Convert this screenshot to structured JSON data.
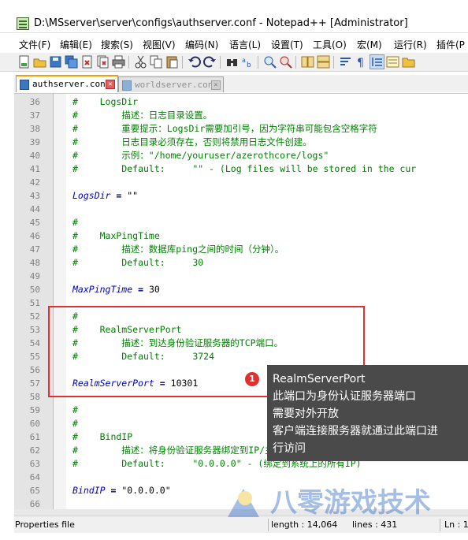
{
  "window": {
    "title": "D:\\MSserver\\server\\configs\\authserver.conf - Notepad++ [Administrator]"
  },
  "menu": [
    {
      "label": "文件(F)"
    },
    {
      "label": "编辑(E)"
    },
    {
      "label": "搜索(S)"
    },
    {
      "label": "视图(V)"
    },
    {
      "label": "编码(N)"
    },
    {
      "label": "语言(L)"
    },
    {
      "label": "设置(T)"
    },
    {
      "label": "工具(O)"
    },
    {
      "label": "宏(M)"
    },
    {
      "label": "运行(R)"
    },
    {
      "label": "插件(P"
    }
  ],
  "toolbar": {
    "icons": [
      "new-file-icon",
      "open-file-icon",
      "save-icon",
      "save-all-icon",
      "close-icon",
      "close-all-icon",
      "print-icon",
      "cut-icon",
      "copy-icon",
      "paste-icon",
      "undo-icon",
      "redo-icon",
      "find-icon",
      "replace-icon",
      "zoom-in-icon",
      "zoom-out-icon",
      "sync-vertical-icon",
      "sync-horizontal-icon",
      "word-wrap-icon",
      "show-all-chars-icon",
      "indent-guide-icon",
      "function-list-icon",
      "folder-icon"
    ]
  },
  "tabs": [
    {
      "label": "authserver.conf",
      "active": true
    },
    {
      "label": "worldserver.conf",
      "active": false
    }
  ],
  "editor": {
    "lines": [
      {
        "num": "36",
        "code": "#    LogsDir",
        "type": "comment"
      },
      {
        "num": "37",
        "code": "#        描述：日志目录设置。",
        "type": "comment"
      },
      {
        "num": "38",
        "code": "#        重要提示：LogsDir需要加引号，因为字符串可能包含空格字符",
        "type": "comment"
      },
      {
        "num": "39",
        "code": "#        日志目录必须存在，否则将禁用日志文件创建。",
        "type": "comment"
      },
      {
        "num": "40",
        "code": "#        示例：\"/home/youruser/azerothcore/logs\"",
        "type": "comment"
      },
      {
        "num": "41",
        "code": "#        Default:     \"\" - (Log files will be stored in the cur",
        "type": "comment"
      },
      {
        "num": "42",
        "code": "",
        "type": "blank"
      },
      {
        "num": "43",
        "key": "LogsDir",
        "op": " = ",
        "val": "\"\"",
        "type": "setting"
      },
      {
        "num": "44",
        "code": "",
        "type": "blank"
      },
      {
        "num": "45",
        "code": "#",
        "type": "comment"
      },
      {
        "num": "46",
        "code": "#    MaxPingTime",
        "type": "comment"
      },
      {
        "num": "47",
        "code": "#        描述：数据库ping之间的时间（分钟）。",
        "type": "comment"
      },
      {
        "num": "48",
        "code": "#        Default:     30",
        "type": "comment"
      },
      {
        "num": "49",
        "code": "",
        "type": "blank"
      },
      {
        "num": "50",
        "key": "MaxPingTime",
        "op": " = ",
        "val": "30",
        "type": "setting"
      },
      {
        "num": "51",
        "code": "",
        "type": "blank"
      },
      {
        "num": "52",
        "code": "#",
        "type": "comment"
      },
      {
        "num": "53",
        "code": "#    RealmServerPort",
        "type": "comment"
      },
      {
        "num": "54",
        "code": "#        描述：到达身份验证服务器的TCP端口。",
        "type": "comment"
      },
      {
        "num": "55",
        "code": "#        Default:     3724",
        "type": "comment"
      },
      {
        "num": "56",
        "code": "",
        "type": "blank"
      },
      {
        "num": "57",
        "key": "RealmServerPort",
        "op": " = ",
        "val": "10301",
        "type": "setting"
      },
      {
        "num": "58",
        "code": "",
        "type": "blank"
      },
      {
        "num": "59",
        "code": "#",
        "type": "comment"
      },
      {
        "num": "60",
        "code": "#",
        "type": "comment"
      },
      {
        "num": "61",
        "code": "#    BindIP",
        "type": "comment"
      },
      {
        "num": "62",
        "code": "#        描述：将身份验证服务器绑定到IP/主机名",
        "type": "comment"
      },
      {
        "num": "63",
        "code": "#        Default:     \"0.0.0.0\" - (绑定到系统上的所有IP)",
        "type": "comment"
      },
      {
        "num": "64",
        "code": "",
        "type": "blank"
      },
      {
        "num": "65",
        "key": "BindIP",
        "op": " = ",
        "val": "\"0.0.0.0\"",
        "type": "setting"
      },
      {
        "num": "66",
        "code": "",
        "type": "blank"
      }
    ]
  },
  "annotation": {
    "badge": "1",
    "lines": [
      "RealmServerPort",
      "此端口为身份认证服务器端口",
      "需要对外开放",
      "客户端连接服务器就通过此端口进",
      "行访问"
    ]
  },
  "status": {
    "file_type": "Properties file",
    "length": "length : 14,064",
    "lines": "lines : 431",
    "ln": "Ln : 1"
  },
  "watermark": {
    "text": "八零游戏技术"
  },
  "colors": {
    "comment": "#008000",
    "key": "#0000c8",
    "highlight_box": "#e03030",
    "tooltip_bg": "#4a4a4a",
    "active_tab_accent": "#f0a000"
  }
}
